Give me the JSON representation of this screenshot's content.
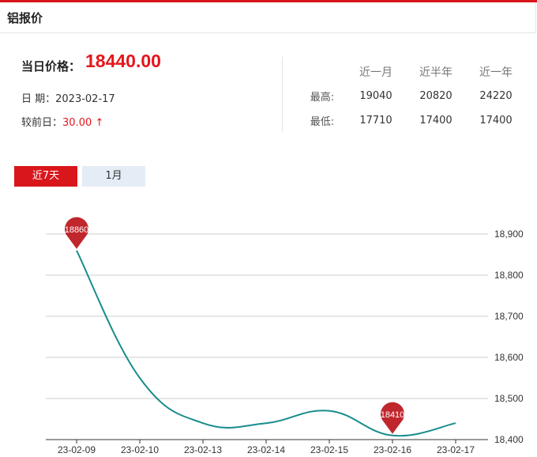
{
  "header": {
    "title": "铝报价"
  },
  "summary": {
    "price_label": "当日价格：",
    "price": "18440.00",
    "date_label": "日 期：",
    "date": "2023-02-17",
    "change_label": "较前日：",
    "change": "30.00",
    "change_arrow": "↑",
    "change_color": "#e4161d"
  },
  "stats": {
    "headers": [
      "近一月",
      "近半年",
      "近一年"
    ],
    "rows": [
      {
        "label": "最高:",
        "values": [
          "19040",
          "20820",
          "24220"
        ]
      },
      {
        "label": "最低:",
        "values": [
          "17710",
          "17400",
          "17400"
        ]
      }
    ]
  },
  "tabs": [
    {
      "label": "近7天",
      "active": true
    },
    {
      "label": "1月",
      "active": false
    }
  ],
  "chart_data": {
    "type": "line",
    "categories": [
      "23-02-09",
      "23-02-10",
      "23-02-13",
      "23-02-14",
      "23-02-15",
      "23-02-16",
      "23-02-17"
    ],
    "values": [
      18860,
      18550,
      18440,
      18440,
      18470,
      18410,
      18440
    ],
    "ylim": [
      18400,
      18900
    ],
    "yticks": [
      18400,
      18500,
      18600,
      18700,
      18800,
      18900
    ],
    "ytick_labels": [
      "18,400",
      "18,500",
      "18,600",
      "18,700",
      "18,800",
      "18,900"
    ],
    "grid": true,
    "line_color": "#1a8c8c",
    "markers": [
      {
        "category": "23-02-09",
        "value": 18860,
        "label": "18860"
      },
      {
        "category": "23-02-16",
        "value": 18410,
        "label": "18410"
      }
    ],
    "marker_color": "#c0272d"
  }
}
